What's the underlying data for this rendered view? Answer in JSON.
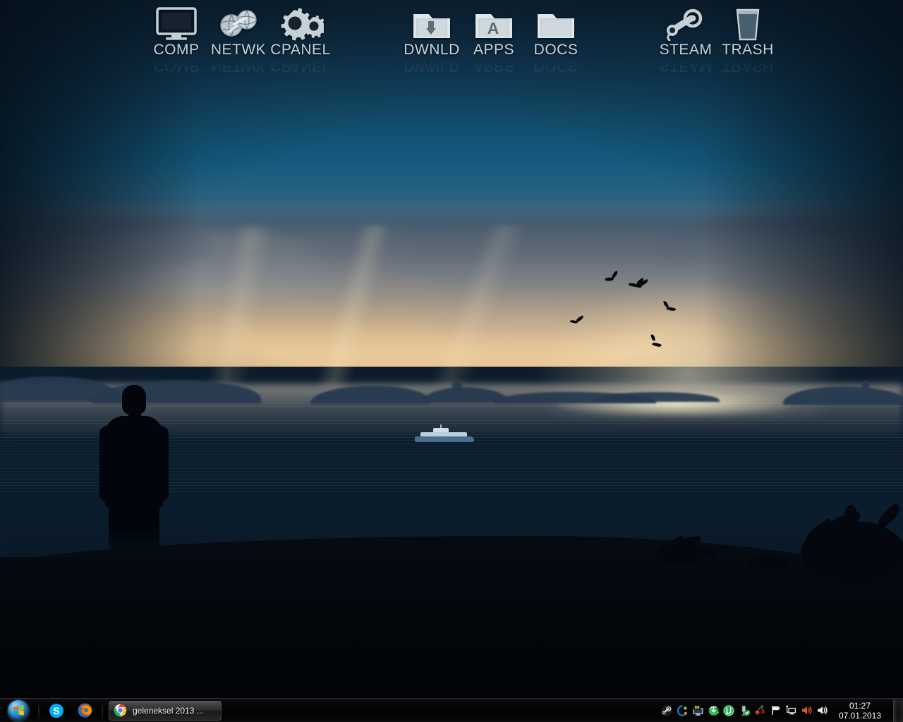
{
  "desktop": {
    "wallpaper_description": "Sunset seascape: silhouetted man in long coat on a dark headland overlooking a calm blue sea, storm clouds with golden light band on the horizon, distant islands, a ferry and six flying birds",
    "colors": {
      "sky_deep": "#10334c",
      "sky_mid": "#135a7e",
      "horizon_gold": "#e7c595",
      "sea_blue": "#23547c",
      "foreground_black": "#04080e",
      "icon_label": "#c8d4da",
      "taskbar_black": "#030303",
      "taskbar_border": "#2b2b2b"
    }
  },
  "icon_dock": {
    "groups": [
      {
        "items": [
          {
            "label": "COMP",
            "icon": "monitor-icon"
          },
          {
            "label": "NETWK",
            "icon": "network-globe-icon"
          },
          {
            "label": "CPANEL",
            "icon": "gears-icon"
          }
        ]
      },
      {
        "items": [
          {
            "label": "DWNLD",
            "icon": "folder-download-icon"
          },
          {
            "label": "APPS",
            "icon": "folder-applications-icon"
          },
          {
            "label": "DOCS",
            "icon": "folder-documents-icon"
          }
        ]
      },
      {
        "items": [
          {
            "label": "STEAM",
            "icon": "steam-icon"
          },
          {
            "label": "TRASH",
            "icon": "trash-bin-icon"
          }
        ]
      }
    ]
  },
  "taskbar": {
    "start_button": {
      "label": "Start",
      "icon": "windows-orb-icon"
    },
    "quick_launch": [
      {
        "name": "Skype",
        "icon": "skype-icon"
      },
      {
        "name": "Firefox",
        "icon": "firefox-icon"
      }
    ],
    "windows": [
      {
        "title": "geleneksel 2013 ...",
        "icon": "chrome-icon",
        "active": true
      }
    ],
    "tray": [
      {
        "name": "Steam",
        "icon": "steam-tray-icon"
      },
      {
        "name": "Acronis",
        "icon": "acronis-tray-icon"
      },
      {
        "name": "Display / Updates 99",
        "icon": "monitor-badge-icon",
        "badge": "99"
      },
      {
        "name": "Internet Download Manager",
        "icon": "idm-tray-icon"
      },
      {
        "name": "uTorrent",
        "icon": "utorrent-tray-icon"
      },
      {
        "name": "Safely Remove Hardware",
        "icon": "usb-eject-icon"
      },
      {
        "name": "Antivirus",
        "icon": "cherry-tray-icon"
      },
      {
        "name": "Action Center",
        "icon": "flag-icon"
      },
      {
        "name": "Network",
        "icon": "network-monitor-icon"
      },
      {
        "name": "Sound Recording",
        "icon": "speaker-orange-icon"
      },
      {
        "name": "Volume",
        "icon": "speaker-icon"
      }
    ],
    "clock": {
      "time": "01:27",
      "date": "07.01.2013"
    },
    "show_desktop": {
      "label": "Show desktop"
    }
  }
}
